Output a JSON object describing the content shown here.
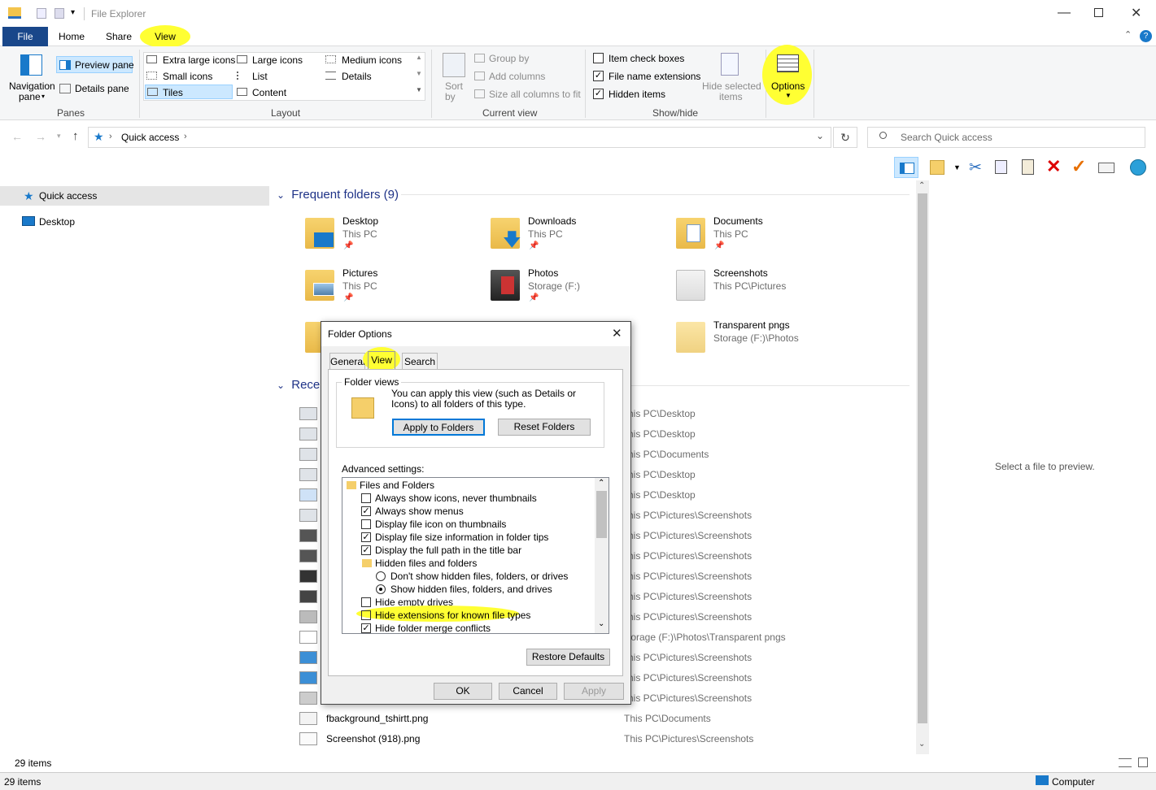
{
  "window": {
    "title": "File Explorer"
  },
  "tabs": {
    "file": "File",
    "home": "Home",
    "share": "Share",
    "view": "View"
  },
  "ribbon": {
    "panes": {
      "label": "Panes",
      "navigation": "Navigation",
      "navigation2": "pane",
      "preview": "Preview pane",
      "details": "Details pane"
    },
    "layout": {
      "label": "Layout",
      "items": [
        "Extra large icons",
        "Large icons",
        "Medium icons",
        "Small icons",
        "List",
        "Details",
        "Tiles",
        "Content"
      ]
    },
    "current_view": {
      "label": "Current view",
      "sort": "Sort",
      "sort2": "by",
      "group": "Group by",
      "add_columns": "Add columns",
      "size_columns": "Size all columns to fit"
    },
    "show_hide": {
      "label": "Show/hide",
      "item_check": "Item check boxes",
      "file_ext": "File name extensions",
      "hidden": "Hidden items",
      "hide_selected": "Hide selected",
      "hide_selected2": "items"
    },
    "options": "Options"
  },
  "address": {
    "location": "Quick access",
    "search_placeholder": "Search Quick access"
  },
  "nav": {
    "quick_access": "Quick access",
    "desktop": "Desktop"
  },
  "content": {
    "frequent_header": "Frequent folders (9)",
    "recent_header": "Recen",
    "folders": [
      {
        "name": "Desktop",
        "loc": "This PC"
      },
      {
        "name": "Downloads",
        "loc": "This PC"
      },
      {
        "name": "Documents",
        "loc": "This PC"
      },
      {
        "name": "Pictures",
        "loc": "This PC"
      },
      {
        "name": "Photos",
        "loc": "Storage (F:)"
      },
      {
        "name": "Screenshots",
        "loc": "This PC\\Pictures"
      },
      {
        "name": "Transparent pngs",
        "loc": "Storage (F:)\\Photos"
      }
    ],
    "recent_paths": [
      "his PC\\Desktop",
      "his PC\\Desktop",
      "his PC\\Documents",
      "his PC\\Desktop",
      "his PC\\Desktop",
      "his PC\\Pictures\\Screenshots",
      "his PC\\Pictures\\Screenshots",
      "his PC\\Pictures\\Screenshots",
      "his PC\\Pictures\\Screenshots",
      "his PC\\Pictures\\Screenshots",
      "his PC\\Pictures\\Screenshots",
      "torage (F:)\\Photos\\Transparent pngs",
      "his PC\\Pictures\\Screenshots",
      "his PC\\Pictures\\Screenshots",
      "his PC\\Pictures\\Screenshots"
    ],
    "recent_files": [
      {
        "name": "fbackground_tshirtt.png",
        "path": "This PC\\Documents"
      },
      {
        "name": "Screenshot (918).png",
        "path": "This PC\\Pictures\\Screenshots"
      }
    ],
    "preview_text": "Select a file to preview."
  },
  "status": {
    "items": "29 items",
    "bottom_items": "29 items",
    "computer": "Computer"
  },
  "dialog": {
    "title": "Folder Options",
    "tabs": {
      "general": "General",
      "view": "View",
      "search": "Search"
    },
    "folder_views": {
      "label": "Folder views",
      "desc": "You can apply this view (such as Details or Icons) to all folders of this type.",
      "apply": "Apply to Folders",
      "reset": "Reset Folders"
    },
    "advanced_label": "Advanced settings:",
    "settings": [
      {
        "label": "Files and Folders",
        "kind": "folder"
      },
      {
        "label": "Always show icons, never thumbnails",
        "kind": "check",
        "checked": false
      },
      {
        "label": "Always show menus",
        "kind": "check",
        "checked": true
      },
      {
        "label": "Display file icon on thumbnails",
        "kind": "check",
        "checked": false
      },
      {
        "label": "Display file size information in folder tips",
        "kind": "check",
        "checked": true
      },
      {
        "label": "Display the full path in the title bar",
        "kind": "check",
        "checked": true
      },
      {
        "label": "Hidden files and folders",
        "kind": "subfolder"
      },
      {
        "label": "Don't show hidden files, folders, or drives",
        "kind": "radio",
        "checked": false
      },
      {
        "label": "Show hidden files, folders, and drives",
        "kind": "radio",
        "checked": true
      },
      {
        "label": "Hide empty drives",
        "kind": "check",
        "checked": false
      },
      {
        "label": "Hide extensions for known file types",
        "kind": "check",
        "checked": false,
        "highlight": true
      },
      {
        "label": "Hide folder merge conflicts",
        "kind": "check",
        "checked": true
      }
    ],
    "restore": "Restore Defaults",
    "ok": "OK",
    "cancel": "Cancel",
    "apply": "Apply"
  },
  "colors": {
    "highlight": "#ffff33",
    "accent": "#1979ca",
    "file_tab": "#19478a"
  }
}
